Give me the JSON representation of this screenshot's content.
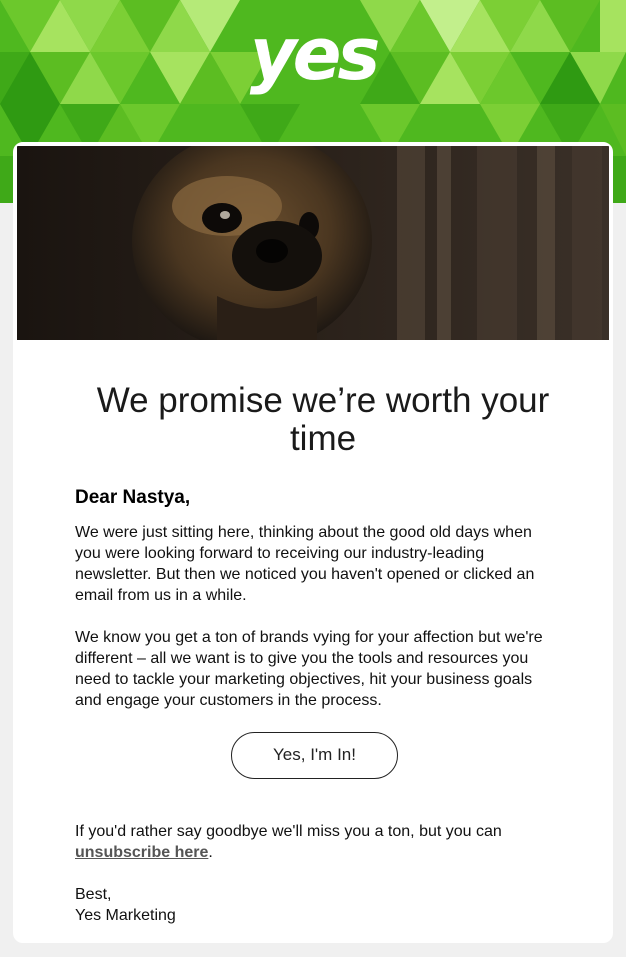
{
  "brand": {
    "logo_text": "yes",
    "colors": {
      "green_light": "#a6e35f",
      "green_mid": "#6cc82c",
      "green_dark": "#2f9a12",
      "card_background": "#ffffff",
      "page_background": "#f0f0f0"
    }
  },
  "hero": {
    "image_subject": "pug-dog-photo"
  },
  "email": {
    "headline": "We promise we’re worth your time",
    "greeting": "Dear Nastya,",
    "paragraph1": "We were just sitting here, thinking about the good old days when you were looking forward to receiving our industry-leading newsletter. But then we noticed you haven't opened or clicked an email from us in a while.",
    "paragraph2": "We know you get a ton of brands vying for your affection but we're different – all we want is to give you the tools and resources you need to tackle your marketing objectives, hit your business goals and engage your customers in the process.",
    "cta_label": "Yes, I'm In!",
    "goodbye_text": "If you'd rather say goodbye we'll miss you a ton, but you can ",
    "unsubscribe_label": "unsubscribe here",
    "goodbye_end": ".",
    "signoff_line1": "Best,",
    "signoff_line2": "Yes Marketing"
  }
}
